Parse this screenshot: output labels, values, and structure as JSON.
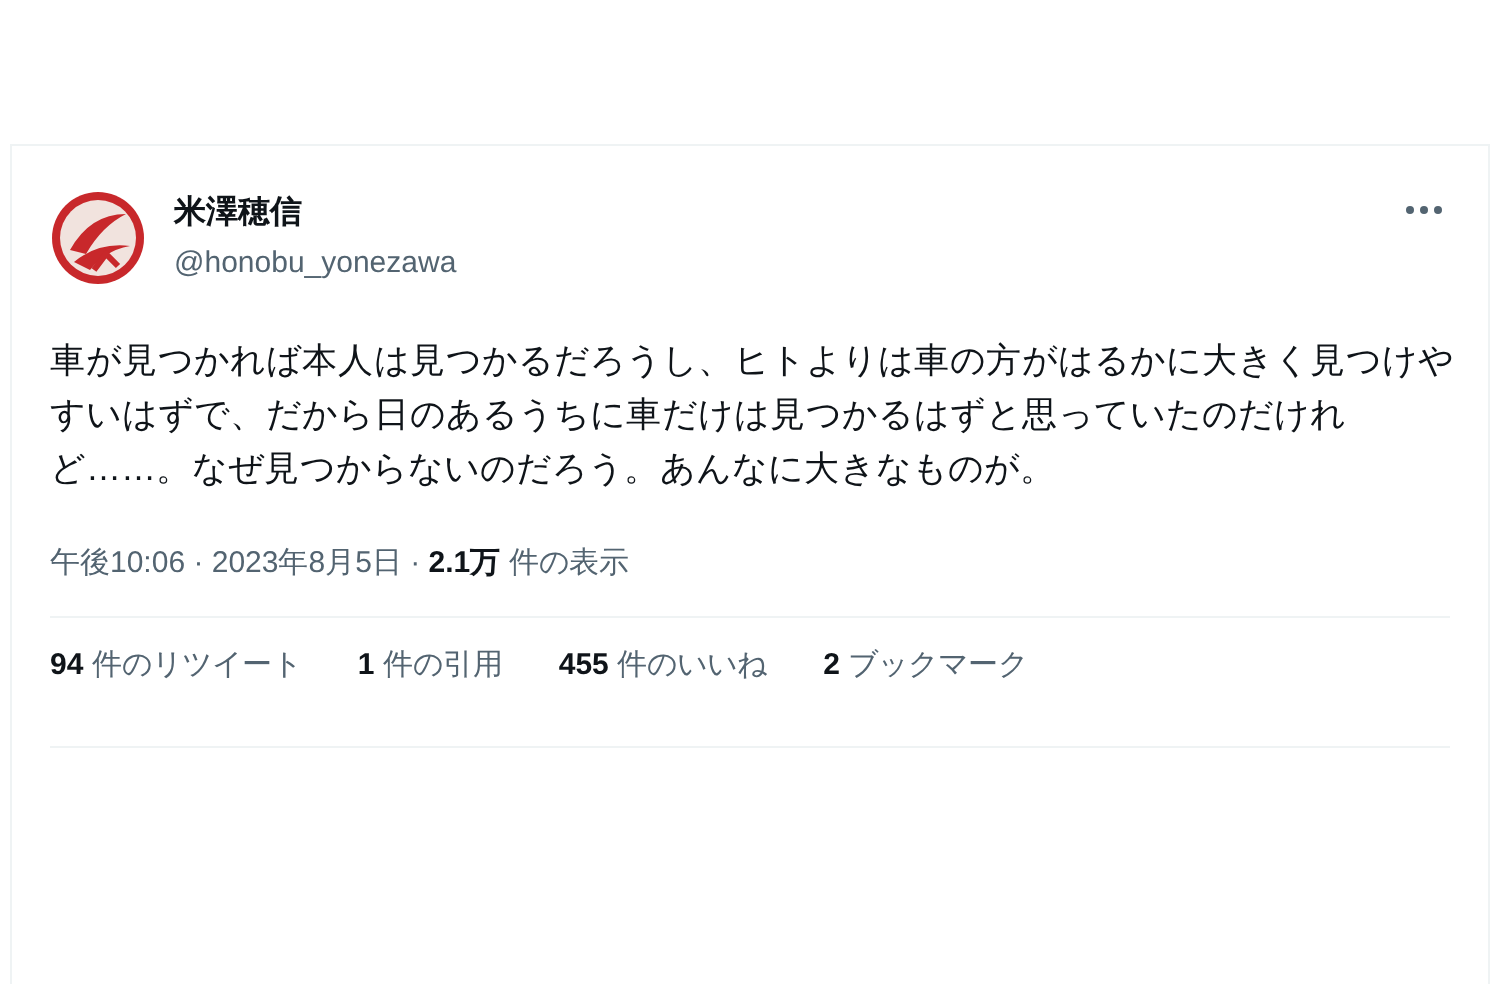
{
  "tweet": {
    "author": {
      "name": "米澤穂信",
      "handle": "@honobu_yonezawa"
    },
    "text": "車が見つかれば本人は見つかるだろうし、ヒトよりは車の方がはるかに大きく見つけやすいはずで、だから日のあるうちに車だけは見つかるはずと思っていたのだけれど……。なぜ見つからないのだろう。あんなに大きなものが。",
    "meta": "午後10:06 · 2023年8月5日 · **2.1万** 件の表示",
    "stats": [
      "**94** 件のリツイート",
      "**1** 件の引用",
      "**455** 件のいいね",
      "**2** ブックマーク"
    ]
  }
}
